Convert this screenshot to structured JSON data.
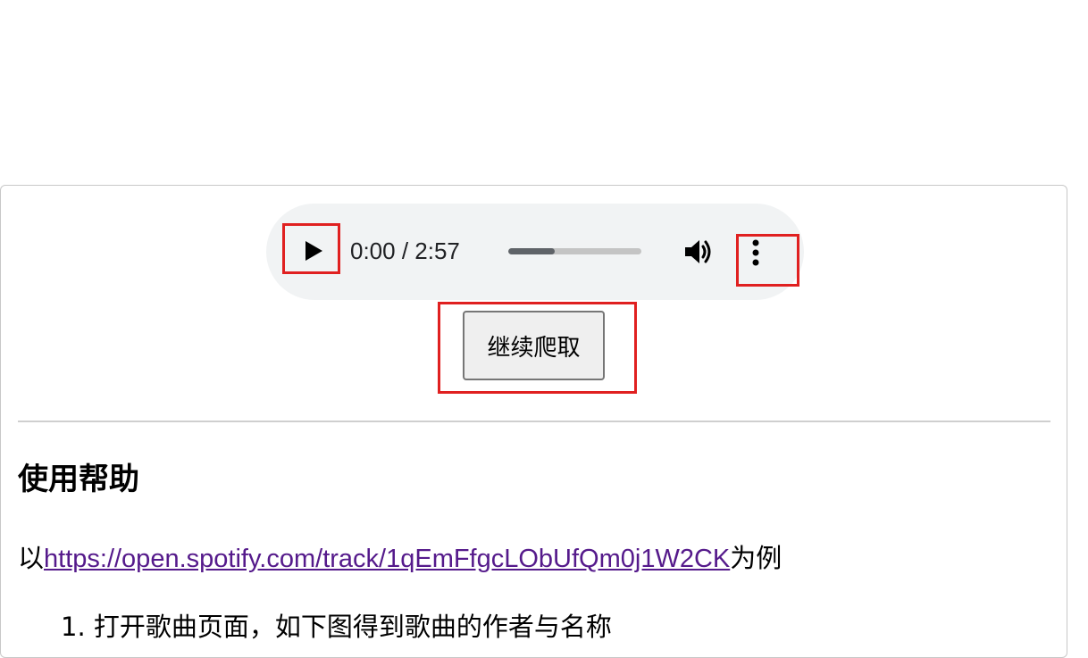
{
  "audio": {
    "current_time": "0:00",
    "separator": " / ",
    "duration": "2:57",
    "progress_fraction": 0.35,
    "play_icon": "play-icon",
    "volume_icon": "volume-icon",
    "more_icon": "more-vertical-icon"
  },
  "actions": {
    "continue_label": "继续爬取"
  },
  "help": {
    "title": "使用帮助",
    "example_prefix": "以",
    "example_link": "https://open.spotify.com/track/1qEmFfgcLObUfQm0j1W2CK",
    "example_suffix": "为例",
    "steps": [
      {
        "number": "1.",
        "text": "打开歌曲页面，如下图得到歌曲的作者与名称"
      }
    ]
  },
  "colors": {
    "annotation_box": "#e02020",
    "link": "#551a8b",
    "player_bg": "#f1f3f4"
  }
}
